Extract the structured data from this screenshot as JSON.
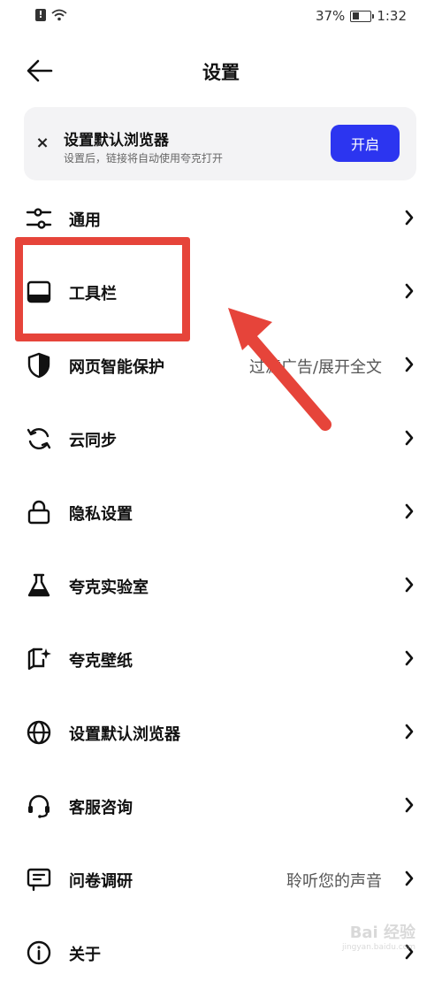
{
  "status_bar": {
    "battery": "37%",
    "time": "1:32",
    "battery_level": 0.37
  },
  "header": {
    "title": "设置"
  },
  "banner": {
    "title": "设置默认浏览器",
    "subtitle": "设置后，链接将自动使用夸克打开",
    "button_label": "开启",
    "close_label": "×",
    "accent_color": "#2c35f0"
  },
  "menu": {
    "items": [
      {
        "label": "通用",
        "value": "",
        "icon": "sliders-icon"
      },
      {
        "label": "工具栏",
        "value": "",
        "icon": "toolbar-icon"
      },
      {
        "label": "网页智能保护",
        "value": "过滤广告/展开全文",
        "icon": "shield-icon"
      },
      {
        "label": "云同步",
        "value": "",
        "icon": "sync-icon"
      },
      {
        "label": "隐私设置",
        "value": "",
        "icon": "lock-icon"
      },
      {
        "label": "夸克实验室",
        "value": "",
        "icon": "flask-icon"
      },
      {
        "label": "夸克壁纸",
        "value": "",
        "icon": "wallpaper-icon"
      },
      {
        "label": "设置默认浏览器",
        "value": "",
        "icon": "globe-icon"
      },
      {
        "label": "客服咨询",
        "value": "",
        "icon": "headset-icon"
      },
      {
        "label": "问卷调研",
        "value": "聆听您的声音",
        "icon": "survey-icon"
      },
      {
        "label": "关于",
        "value": "",
        "icon": "info-icon"
      }
    ]
  },
  "annotation": {
    "highlight_color": "#e6443a"
  },
  "watermark": {
    "brand": "Bai 经验",
    "url": "jingyan.baidu.com"
  }
}
